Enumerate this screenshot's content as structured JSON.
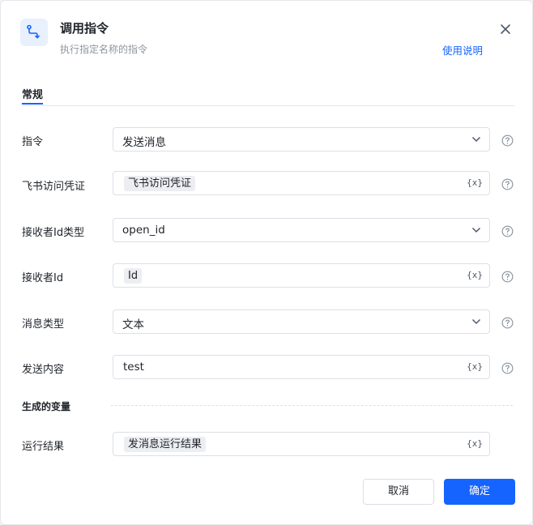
{
  "header": {
    "title": "调用指令",
    "subtitle": "执行指定名称的指令",
    "help_link": "使用说明",
    "icon": "command-flow-icon",
    "close_icon": "close-icon"
  },
  "tabs": [
    {
      "label": "常规",
      "active": true
    }
  ],
  "fields": [
    {
      "label": "指令",
      "type": "select",
      "value": "发送消息"
    },
    {
      "label": "飞书访问凭证",
      "type": "variable",
      "value": "飞书访问凭证"
    },
    {
      "label": "接收者Id类型",
      "type": "select",
      "value": "open_id"
    },
    {
      "label": "接收者Id",
      "type": "variable",
      "value": "Id"
    },
    {
      "label": "消息类型",
      "type": "select",
      "value": "文本"
    },
    {
      "label": "发送内容",
      "type": "text",
      "value": "test"
    }
  ],
  "variable_icon_text": "{x}",
  "outputs": {
    "section_label": "生成的变量",
    "items": [
      {
        "label": "运行结果",
        "value": "发消息运行结果"
      }
    ]
  },
  "buttons": {
    "cancel": "取消",
    "confirm": "确定"
  },
  "colors": {
    "accent": "#1664ff",
    "icon_bg": "#e8f0fd",
    "chip_bg": "#eceef2"
  }
}
